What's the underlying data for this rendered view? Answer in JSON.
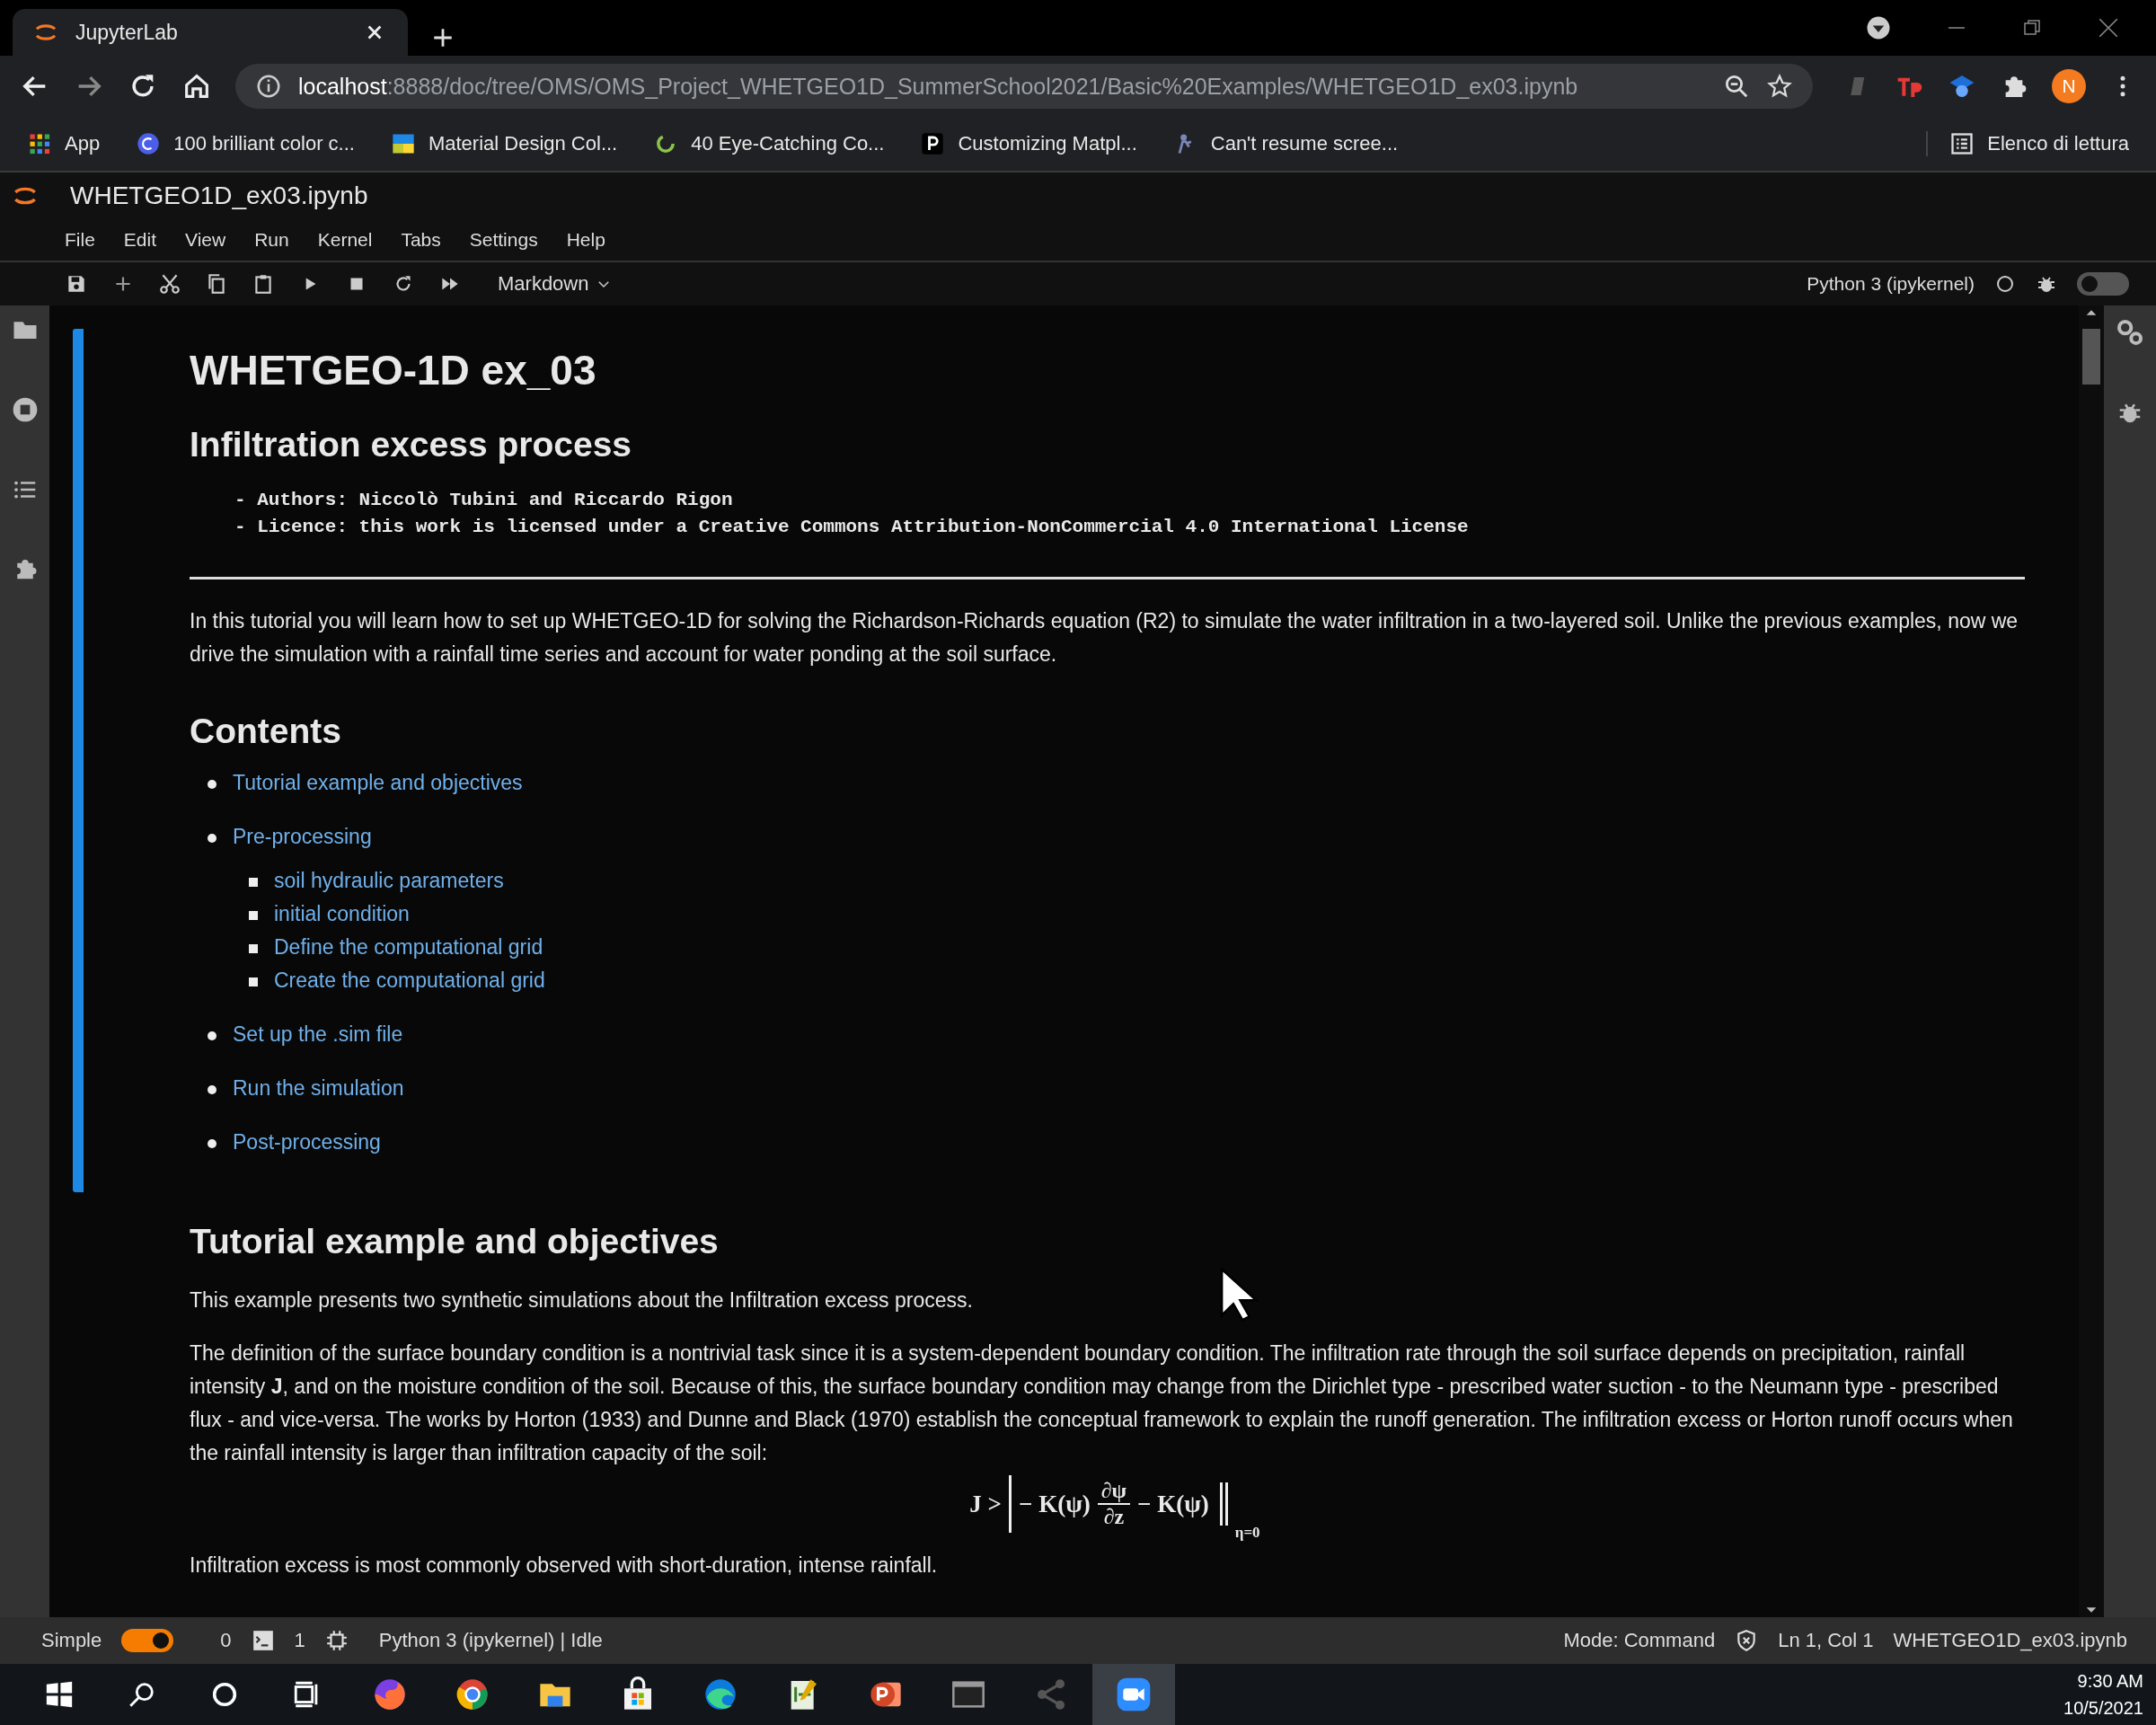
{
  "browser": {
    "tab": {
      "title": "JupyterLab",
      "selected": true
    },
    "url": {
      "host": "localhost",
      "rest": ":8888/doc/tree/OMS/OMS_Project_WHETGEO1D_SummerSchool2021/Basic%20Examples/WHETGEO1D_ex03.ipynb"
    },
    "profile_initial": "N",
    "bookmarks": [
      {
        "kind": "apps",
        "label": "App"
      },
      {
        "kind": "circle",
        "label": "100 brilliant color c..."
      },
      {
        "kind": "squares",
        "label": "Material Design Col..."
      },
      {
        "kind": "ring",
        "label": "40 Eye-Catching Co..."
      },
      {
        "kind": "letter",
        "label": "Customizing Matpl..."
      },
      {
        "kind": "figure",
        "label": "Can't resume scree..."
      }
    ],
    "reading_list": "Elenco di lettura"
  },
  "jupyter": {
    "document_title": "WHETGEO1D_ex03.ipynb",
    "menu": [
      "File",
      "Edit",
      "View",
      "Run",
      "Kernel",
      "Tabs",
      "Settings",
      "Help"
    ],
    "cell_type": "Markdown",
    "kernel": "Python 3 (ipykernel)",
    "debugger_on": false
  },
  "notebook": {
    "cells": [
      {
        "active": true,
        "title": "WHETGEO-1D ex_03",
        "subtitle": "Infiltration excess process",
        "code_lines": [
          "- Authors: Niccolò Tubini and Riccardo Rigon",
          "- Licence: this work is licensed under a Creative Commons Attribution-NonCommercial 4.0 International License"
        ],
        "paragraphs": [
          "In this tutorial you will learn how to set up WHETGEO-1D for solving the Richardson-Richards equation (R2) to simulate the water infiltration in a two-layered soil. Unlike the previous examples, now we drive the simulation with a rainfall time series and account for water ponding at the soil surface."
        ],
        "contents_title": "Contents",
        "contents": [
          {
            "text": "Tutorial example and objectives"
          },
          {
            "text": "Pre-processing",
            "children": [
              {
                "text": "soil hydraulic parameters"
              },
              {
                "text": "initial condition"
              },
              {
                "text": "Define the computational grid"
              },
              {
                "text": "Create the computational grid"
              }
            ]
          },
          {
            "text": "Set up the .sim file"
          },
          {
            "text": "Run the simulation"
          },
          {
            "text": "Post-processing"
          }
        ]
      },
      {
        "active": false,
        "section_title": "Tutorial example and objectives",
        "paragraphs": [
          "This example presents two synthetic simulations about the Infiltration excess process.",
          "The definition of the surface boundary condition is a nontrivial task since it is a system-dependent boundary condition. The infiltration rate through the soil surface depends on precipitation, rainfall intensity **J**, and on the moisture condition of the soil. Because of this, the surface boundary condition may change from the Dirichlet type - prescribed water suction - to the Neumann type - prescribed flux - and vice-versa. The works by Horton (1933) and Dunne and Black (1970) establish the conceptual framework to explain the runoff generation. The infiltration excess or Horton runoff occurs when the rainfall intensity is larger than infiltration capacity of the soil:"
        ],
        "formula": {
          "left": "J >",
          "term_1": "− K(ψ)",
          "numerator": "∂ψ",
          "denominator": "∂z",
          "term_2": "− K(ψ)",
          "subscript": "η=0"
        },
        "closing": "Infiltration excess is most commonly observed with short-duration, intense rainfall."
      }
    ]
  },
  "status_bar": {
    "mode_label": "Simple",
    "simple_on": true,
    "terminals": "0",
    "kernels": "1",
    "kernel_status": "Python 3 (ipykernel) | Idle",
    "mode": "Mode: Command",
    "position": "Ln 1, Col 1",
    "file": "WHETGEO1D_ex03.ipynb"
  },
  "taskbar": {
    "apps": [
      {
        "kind": "fox",
        "selected": false
      },
      {
        "kind": "globe",
        "selected": false
      },
      {
        "kind": "folder",
        "selected": false
      },
      {
        "kind": "bag",
        "selected": false
      },
      {
        "kind": "wave",
        "selected": false
      },
      {
        "kind": "notepad",
        "selected": false
      },
      {
        "kind": "slides",
        "selected": false
      },
      {
        "kind": "terminal",
        "selected": false
      },
      {
        "kind": "share",
        "selected": false
      },
      {
        "kind": "camera",
        "selected": true
      }
    ],
    "time": "9:30 AM",
    "date": "10/5/2021"
  }
}
